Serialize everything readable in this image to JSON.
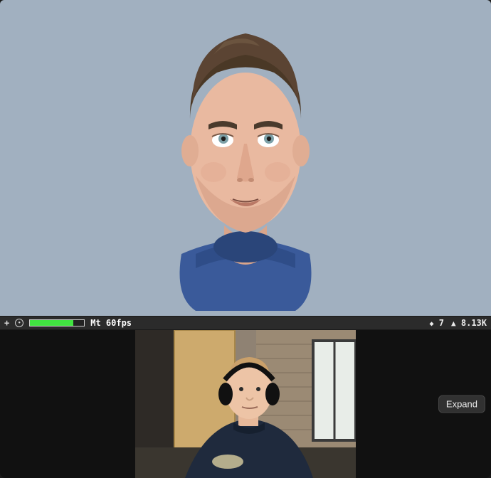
{
  "viewport": {
    "background_color": "#a1b0c0",
    "avatar": {
      "description": "3d-avatar-bust",
      "hair_color": "#5b4433",
      "skin_color": "#e9b9a0",
      "eye_color": "#7ca0a7",
      "shirt_color": "#3a5a9a"
    }
  },
  "stats_bar": {
    "add_icon": "+",
    "target_icon": "◎",
    "progress_percent": 80,
    "fps_label": "Mt 60fps",
    "draw_calls_icon": "◆",
    "draw_calls": "7",
    "tris_icon": "▲",
    "tris": "8.13K"
  },
  "webcam": {
    "description": "live-camera-feed",
    "expand_label": "Expand"
  }
}
